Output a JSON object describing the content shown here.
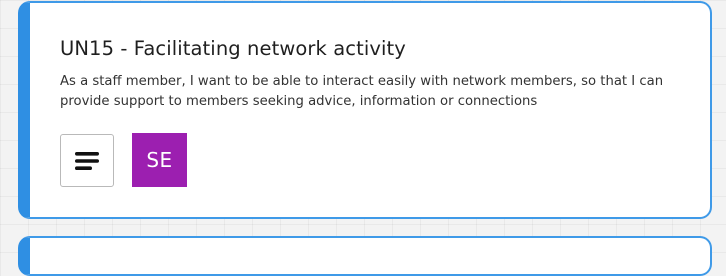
{
  "card": {
    "title": "UN15 - Facilitating network activity",
    "description": "As a staff member, I want to be able to interact easily with network members, so that I can provide support to members seeking advice, information or connections",
    "description_icon": "text-lines-icon",
    "assignee_initials": "SE",
    "assignee_color": "#9c1fb0",
    "accent_color": "#2f8fe3"
  }
}
